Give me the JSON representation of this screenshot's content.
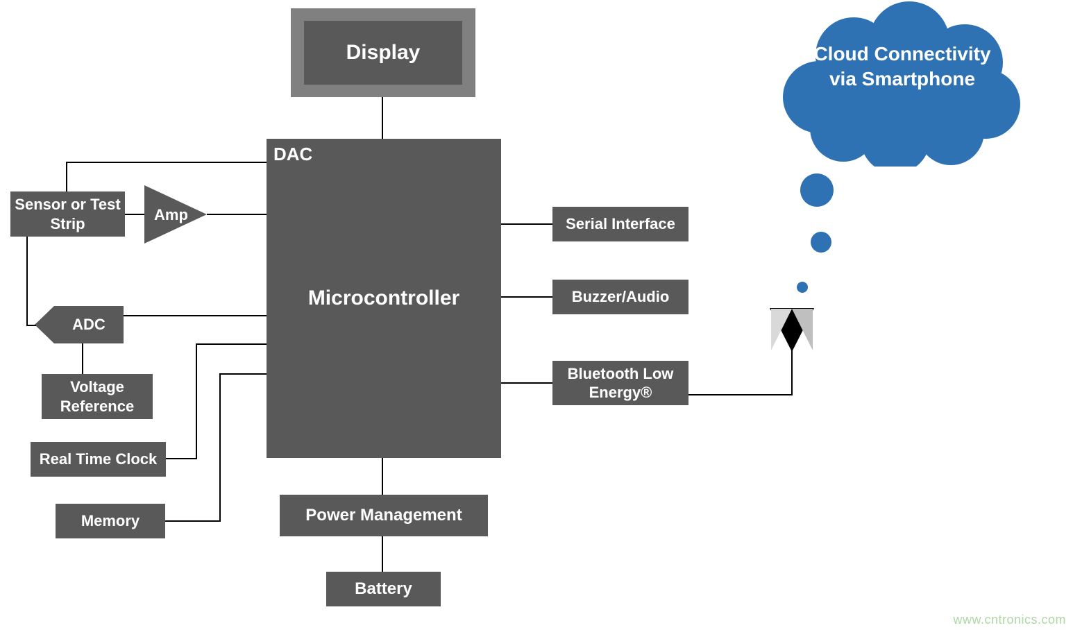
{
  "blocks": {
    "display": "Display",
    "microcontroller": {
      "dac_label": "DAC",
      "title": "Microcontroller"
    },
    "sensor": "Sensor or Test Strip",
    "amp": "Amp",
    "adc": "ADC",
    "voltage_ref": "Voltage Reference",
    "rtc": "Real Time Clock",
    "memory": "Memory",
    "power_mgmt": "Power Management",
    "battery": "Battery",
    "serial": "Serial Interface",
    "buzzer": "Buzzer/Audio",
    "ble": "Bluetooth Low Energy®"
  },
  "cloud": {
    "text": "Cloud Connectivity via Smartphone"
  },
  "watermark": "www.cntronics.com",
  "colors": {
    "block_bg": "#595959",
    "cloud_fill": "#2f72b4",
    "display_frame": "#808080",
    "antenna_light": "#d9d9d9",
    "antenna_dark": "#bfbfbf"
  }
}
